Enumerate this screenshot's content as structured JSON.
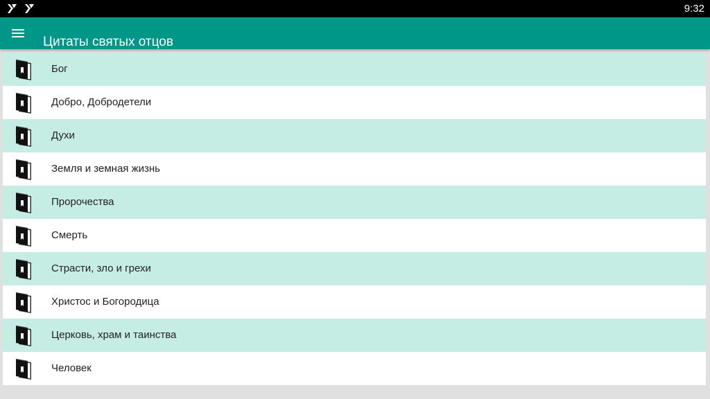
{
  "status_bar": {
    "time": "9:32",
    "icons": [
      "notification-app-icon",
      "notification-app-icon"
    ]
  },
  "app_bar": {
    "menu_icon": "hamburger-menu-icon",
    "title": "Цитаты святых отцов"
  },
  "colors": {
    "app_bar": "#009688",
    "row_alt": "#c5ede4",
    "row": "#ffffff",
    "background": "#e0e0e0"
  },
  "list": {
    "item_icon": "book-icon",
    "items": [
      {
        "label": "Бог"
      },
      {
        "label": "Добро, Добродетели"
      },
      {
        "label": "Духи"
      },
      {
        "label": "Земля и земная жизнь"
      },
      {
        "label": "Пророчества"
      },
      {
        "label": "Смерть"
      },
      {
        "label": "Страсти, зло и грехи"
      },
      {
        "label": "Христос и Богородица"
      },
      {
        "label": "Церковь, храм и таинства"
      },
      {
        "label": "Человек"
      }
    ]
  }
}
